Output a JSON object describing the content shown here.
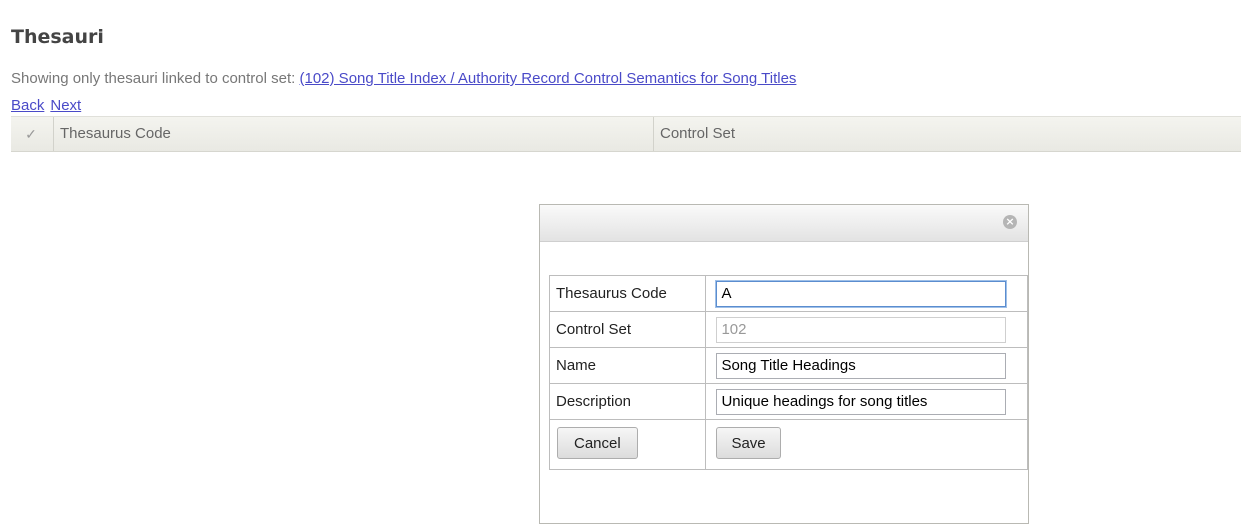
{
  "page": {
    "title": "Thesauri",
    "filter_prefix": "Showing only thesauri linked to control set: ",
    "filter_link": "(102) Song Title Index / Authority Record Control Semantics for Song Titles",
    "back_link": "Back",
    "next_link": "Next"
  },
  "grid": {
    "check_glyph": "✓",
    "columns": [
      "Thesaurus Code",
      "Control Set"
    ]
  },
  "dialog": {
    "close_glyph": "×",
    "fields": {
      "thesaurus_code": {
        "label": "Thesaurus Code",
        "value": "A"
      },
      "control_set": {
        "label": "Control Set",
        "value": "102"
      },
      "name": {
        "label": "Name",
        "value": "Song Title Headings"
      },
      "description": {
        "label": "Description",
        "value": "Unique headings for song titles"
      }
    },
    "cancel_label": "Cancel",
    "save_label": "Save"
  }
}
